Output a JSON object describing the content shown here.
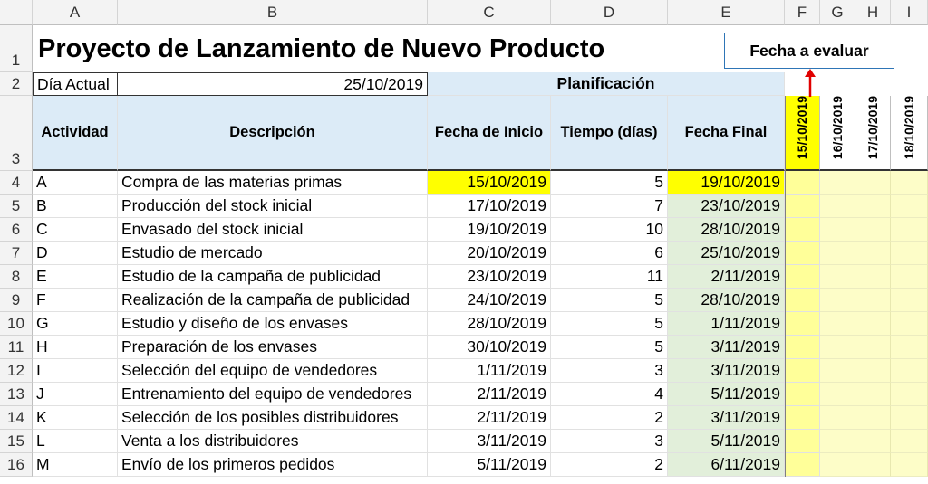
{
  "columns": [
    "A",
    "B",
    "C",
    "D",
    "E",
    "F",
    "G",
    "H",
    "I"
  ],
  "rows": [
    "1",
    "2",
    "3",
    "4",
    "5",
    "6",
    "7",
    "8",
    "9",
    "10",
    "11",
    "12",
    "13",
    "14",
    "15",
    "16"
  ],
  "title": "Proyecto de Lanzamiento de Nuevo Producto",
  "eval_label": "Fecha a evaluar",
  "current_day": {
    "label": "Día Actual",
    "value": "25/10/2019"
  },
  "planning_header": "Planificación",
  "headers": {
    "activity": "Actividad",
    "description": "Descripción",
    "start": "Fecha de Inicio",
    "duration": "Tiempo (días)",
    "end": "Fecha Final"
  },
  "timeline_dates": [
    "15/10/2019",
    "16/10/2019",
    "17/10/2019",
    "18/10/2019"
  ],
  "activities": [
    {
      "id": "A",
      "desc": "Compra de las materias primas",
      "start": "15/10/2019",
      "days": "5",
      "end": "19/10/2019"
    },
    {
      "id": "B",
      "desc": "Producción del stock inicial",
      "start": "17/10/2019",
      "days": "7",
      "end": "23/10/2019"
    },
    {
      "id": "C",
      "desc": "Envasado del stock inicial",
      "start": "19/10/2019",
      "days": "10",
      "end": "28/10/2019"
    },
    {
      "id": "D",
      "desc": "Estudio de mercado",
      "start": "20/10/2019",
      "days": "6",
      "end": "25/10/2019"
    },
    {
      "id": "E",
      "desc": "Estudio de la campaña de publicidad",
      "start": "23/10/2019",
      "days": "11",
      "end": "2/11/2019"
    },
    {
      "id": "F",
      "desc": "Realización de la campaña de publicidad",
      "start": "24/10/2019",
      "days": "5",
      "end": "28/10/2019"
    },
    {
      "id": "G",
      "desc": "Estudio y diseño de los envases",
      "start": "28/10/2019",
      "days": "5",
      "end": "1/11/2019"
    },
    {
      "id": "H",
      "desc": "Preparación de los envases",
      "start": "30/10/2019",
      "days": "5",
      "end": "3/11/2019"
    },
    {
      "id": "I",
      "desc": "Selección del equipo de vendedores",
      "start": "1/11/2019",
      "days": "3",
      "end": "3/11/2019"
    },
    {
      "id": "J",
      "desc": "Entrenamiento del equipo de vendedores",
      "start": "2/11/2019",
      "days": "4",
      "end": "5/11/2019"
    },
    {
      "id": "K",
      "desc": "Selección de los posibles distribuidores",
      "start": "2/11/2019",
      "days": "2",
      "end": "3/11/2019"
    },
    {
      "id": "L",
      "desc": "Venta a los distribuidores",
      "start": "3/11/2019",
      "days": "3",
      "end": "5/11/2019"
    },
    {
      "id": "M",
      "desc": "Envío de los primeros pedidos",
      "start": "5/11/2019",
      "days": "2",
      "end": "6/11/2019"
    }
  ],
  "colors": {
    "highlight": "#ffff00",
    "header_fill": "#dcebf7",
    "end_fill": "#e2efda",
    "gantt_fill": "#fdfdc8",
    "arrow": "#e00000"
  }
}
